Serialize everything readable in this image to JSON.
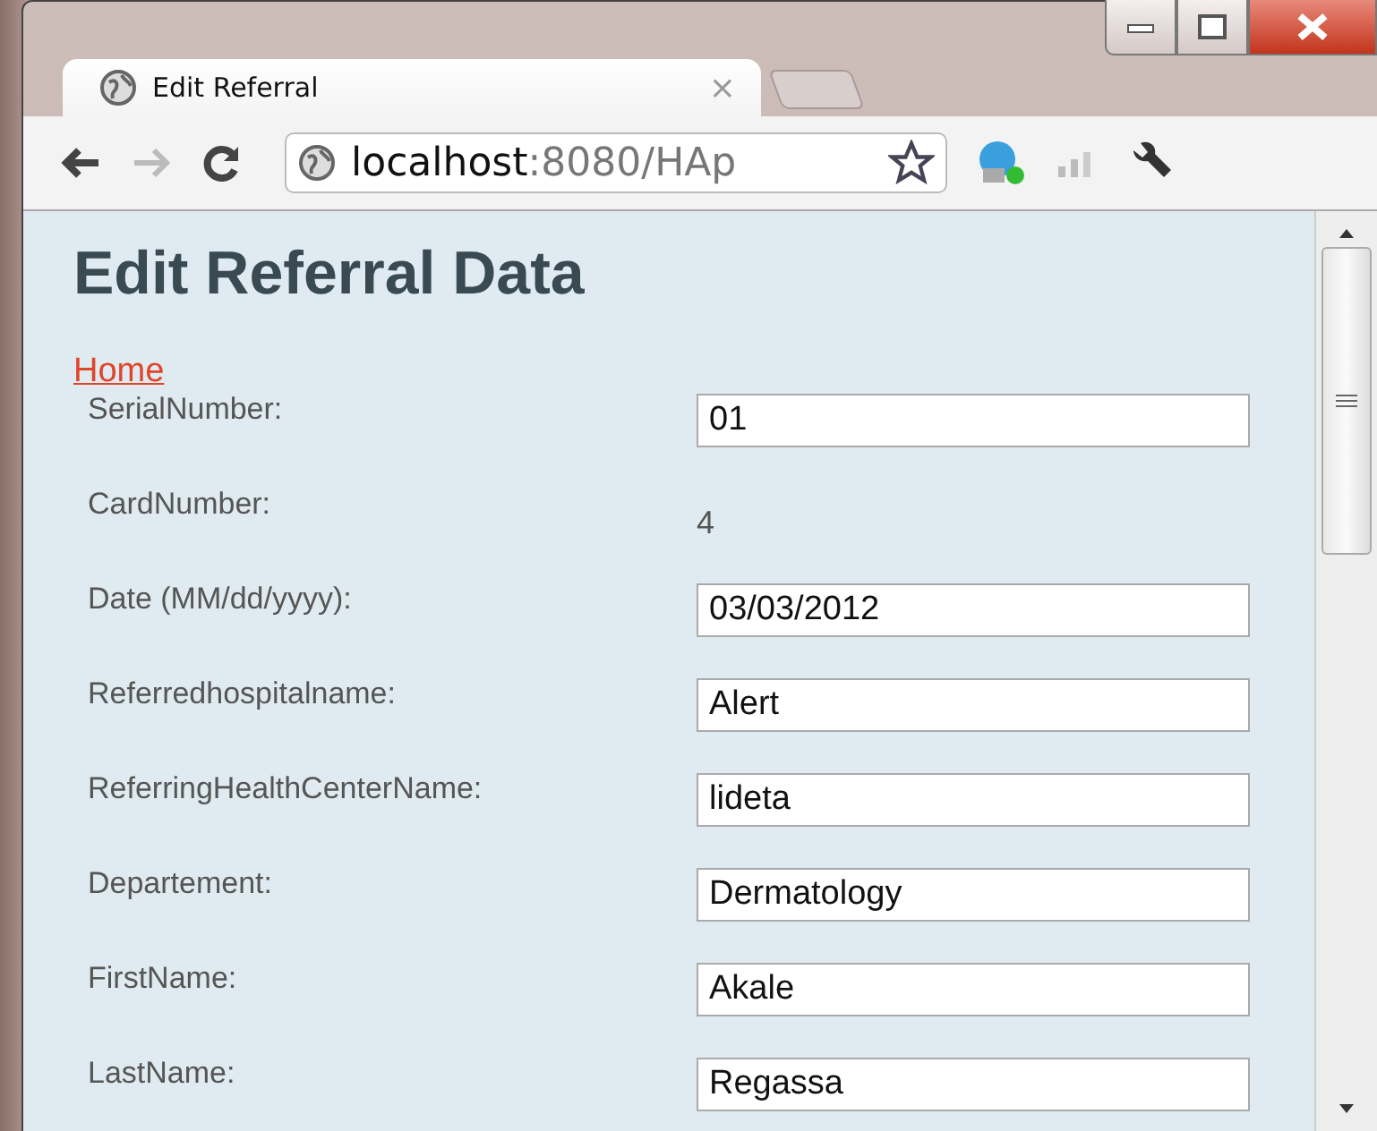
{
  "tab": {
    "title": "Edit Referral",
    "close": "×"
  },
  "address": {
    "host": "localhost",
    "path": ":8080/HAp"
  },
  "page": {
    "heading": "Edit Referral Data",
    "home_link": "Home"
  },
  "fields": [
    {
      "kind": "input",
      "label": "SerialNumber:",
      "value": "01"
    },
    {
      "kind": "text",
      "label": "CardNumber:",
      "value": "4"
    },
    {
      "kind": "input",
      "label": "Date (MM/dd/yyyy):",
      "value": "03/03/2012"
    },
    {
      "kind": "input",
      "label": "Referredhospitalname:",
      "value": "Alert"
    },
    {
      "kind": "input",
      "label": "ReferringHealthCenterName:",
      "value": "lideta"
    },
    {
      "kind": "input",
      "label": "Departement:",
      "value": "Dermatology"
    },
    {
      "kind": "input",
      "label": "FirstName:",
      "value": "Akale"
    },
    {
      "kind": "input",
      "label": "LastName:",
      "value": "Regassa"
    }
  ]
}
